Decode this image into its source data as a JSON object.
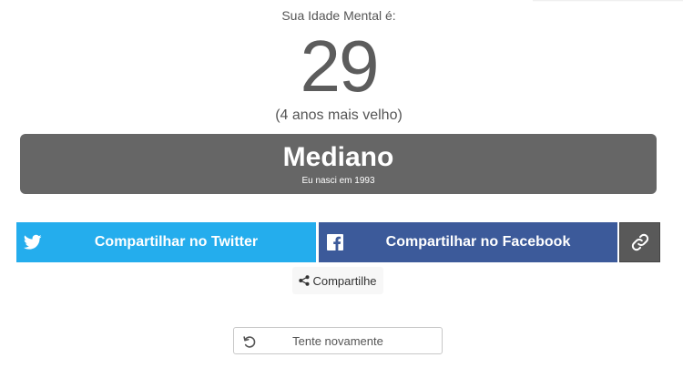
{
  "result": {
    "label": "Sua Idade Mental é:",
    "age": "29",
    "difference": "(4 anos mais velho)"
  },
  "verdict": {
    "title": "Mediano",
    "subtitle": "Eu nasci em 1993"
  },
  "share": {
    "twitter_label": "Compartilhar no Twitter",
    "facebook_label": "Compartilhar no Facebook",
    "more_label": "Compartilhe",
    "twitter_color": "#24aded",
    "facebook_color": "#3c5a9a",
    "link_color": "#595959",
    "twitter_icon": "twitter-bird-icon",
    "facebook_icon": "facebook-icon",
    "link_icon": "link-icon",
    "more_icon": "share-icon"
  },
  "retry": {
    "label": "Tente novamente",
    "icon": "retry-icon"
  },
  "colors": {
    "verdict_bg": "#666666"
  }
}
